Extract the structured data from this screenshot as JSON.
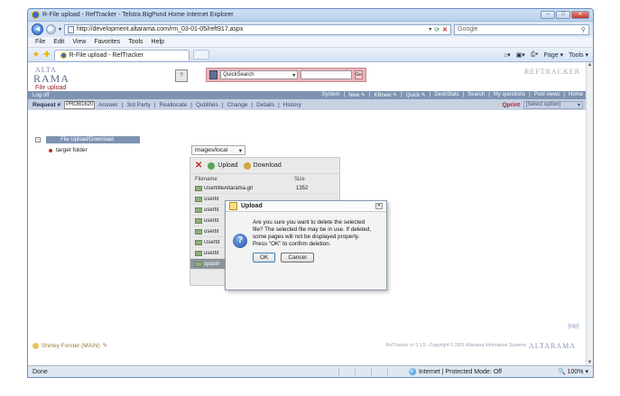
{
  "browser": {
    "title": "R-File upload - RefTracker - Telstra BigPond Home Internet Explorer",
    "url": "http://development.altarama.com/rm_03-01-05/reft917.aspx",
    "search_placeholder": "Google",
    "menu": [
      "File",
      "Edit",
      "View",
      "Favorites",
      "Tools",
      "Help"
    ],
    "tab_label": "R-File upload - RefTracker",
    "commands": [
      "Page ▾",
      "Tools ▾"
    ],
    "status": "Done",
    "zone": "Internet | Protected Mode: Off",
    "zoom": "100%"
  },
  "app": {
    "logo_top": "ALTA",
    "logo_main": "RAMA",
    "page_title": "File upload",
    "help_label": "?",
    "quicksearch_label": "QuickSearch",
    "go_label": "Go",
    "brand_right": "REFTRACKER",
    "logoff": "Log off",
    "top_links": [
      "System",
      "|",
      "New ✎",
      "|",
      "KBnew ✎",
      "|",
      "Quick ✎",
      "|",
      "DeskStats",
      "|",
      "Search",
      "|",
      "My questions",
      "|",
      "Pool views",
      "|",
      "Home"
    ],
    "request_label": "Request #",
    "request_value": "PROB1620",
    "sub_links": [
      "Answer",
      "|",
      "3rd Party",
      "|",
      "Reallocate",
      "|",
      "Qutilities",
      "|",
      "Change",
      "|",
      "Details",
      "|",
      "History"
    ],
    "qprint_label": "Qprint",
    "qprint_option": "[Select option]"
  },
  "tree": {
    "header": "File Upload/Download",
    "item": "target folder"
  },
  "panel": {
    "folder": "images/local",
    "delete_label": "",
    "upload_label": "Upload",
    "download_label": "Download",
    "col_filename": "Filename",
    "col_size": "Size",
    "files": [
      {
        "name": "UsertitleAltarama.gif",
        "size": "1352"
      },
      {
        "name": "usertit",
        "size": ""
      },
      {
        "name": "usertit",
        "size": ""
      },
      {
        "name": "usertit",
        "size": ""
      },
      {
        "name": "usertit",
        "size": ""
      },
      {
        "name": "Usertit",
        "size": ""
      },
      {
        "name": "usertit",
        "size": ""
      },
      {
        "name": "splash",
        "size": ""
      }
    ]
  },
  "dialog": {
    "title": "Upload",
    "message": "Are you sure you want to delete the selected file? The selected file may be in use. If deleted, some pages will not be displayed properly. Press \"OK\" to confirm deletion.",
    "ok_label": "OK",
    "cancel_label": "Cancel"
  },
  "footer": {
    "top_link": "[top]",
    "user": "Shirley Forster (MAIN)",
    "copyright": "RefTracker v# 3.1.5 - Copyright © 2001 Altarama Information Systems",
    "brand": "ALTARAMA"
  }
}
